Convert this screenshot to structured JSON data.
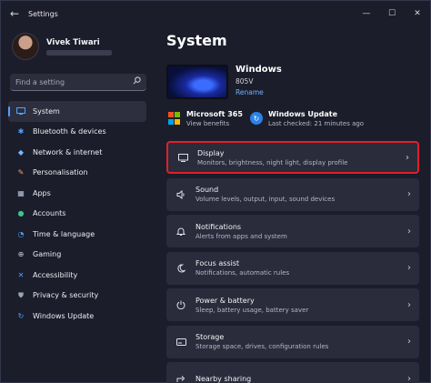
{
  "window": {
    "title": "Settings",
    "back_glyph": "←",
    "controls": {
      "minimize": "—",
      "maximize": "☐",
      "close": "✕"
    }
  },
  "user": {
    "name": "Vivek Tiwari"
  },
  "search": {
    "placeholder": "Find a setting",
    "icon": "search-icon"
  },
  "nav": {
    "items": [
      {
        "label": "System",
        "icon": "system-icon",
        "active": true
      },
      {
        "label": "Bluetooth & devices",
        "icon": "bluetooth-icon"
      },
      {
        "label": "Network & internet",
        "icon": "network-icon"
      },
      {
        "label": "Personalisation",
        "icon": "brush-icon"
      },
      {
        "label": "Apps",
        "icon": "apps-icon"
      },
      {
        "label": "Accounts",
        "icon": "accounts-icon"
      },
      {
        "label": "Time & language",
        "icon": "time-language-icon"
      },
      {
        "label": "Gaming",
        "icon": "gaming-icon"
      },
      {
        "label": "Accessibility",
        "icon": "accessibility-icon"
      },
      {
        "label": "Privacy & security",
        "icon": "shield-icon"
      },
      {
        "label": "Windows Update",
        "icon": "windows-update-icon"
      }
    ]
  },
  "main": {
    "title": "System",
    "device": {
      "name": "Windows",
      "model": "805V",
      "rename": "Rename"
    },
    "quick": [
      {
        "title": "Microsoft 365",
        "subtitle": "View benefits"
      },
      {
        "title": "Windows Update",
        "subtitle": "Last checked: 21 minutes ago"
      }
    ],
    "cards": [
      {
        "title": "Display",
        "subtitle": "Monitors, brightness, night light, display profile",
        "icon": "display-icon",
        "glyph": "▭"
      },
      {
        "title": "Sound",
        "subtitle": "Volume levels, output, input, sound devices",
        "icon": "sound-icon",
        "glyph": "🔈"
      },
      {
        "title": "Notifications",
        "subtitle": "Alerts from apps and system",
        "icon": "bell-icon",
        "glyph": "🔔"
      },
      {
        "title": "Focus assist",
        "subtitle": "Notifications, automatic rules",
        "icon": "focus-assist-icon",
        "glyph": "☾"
      },
      {
        "title": "Power & battery",
        "subtitle": "Sleep, battery usage, battery saver",
        "icon": "power-icon",
        "glyph": "⏻"
      },
      {
        "title": "Storage",
        "subtitle": "Storage space, drives, configuration rules",
        "icon": "storage-icon",
        "glyph": "▤"
      },
      {
        "title": "Nearby sharing",
        "subtitle": "",
        "icon": "nearby-sharing-icon",
        "glyph": "⇪"
      }
    ],
    "chevron": "›"
  },
  "colors": {
    "accent": "#4da3ff",
    "highlight_border": "#e01f2a",
    "background": "#1c1d2b",
    "card": "#2a2b3b"
  }
}
